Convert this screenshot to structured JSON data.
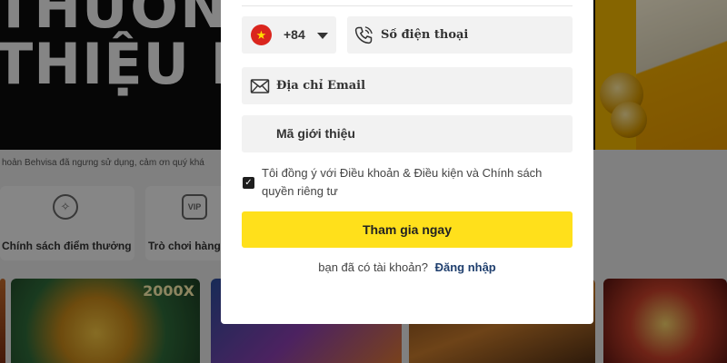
{
  "background": {
    "hero": {
      "line1": "THƯƠNG G",
      "line2": "THIỆU BẠ"
    },
    "notice": "hoản Behvisa đã ngưng sử dụng, cảm ơn quý khá",
    "categories": [
      {
        "label": "Chính sách điểm thưởng",
        "icon": "crest-icon"
      },
      {
        "label": "Trò chơi hàng",
        "icon": "vip-icon"
      }
    ],
    "games": [
      {
        "badge": "2000X"
      },
      {
        "badge": ""
      },
      {
        "badge": ""
      },
      {
        "badge": ""
      }
    ]
  },
  "form": {
    "country": {
      "flag": "vietnam-flag",
      "dial_code": "+84"
    },
    "phone": {
      "placeholder": "Số điện thoại",
      "value": ""
    },
    "email": {
      "placeholder": "Địa chỉ Email",
      "value": ""
    },
    "referral": {
      "placeholder": "Mã giới thiệu",
      "value": ""
    },
    "terms": {
      "checked": true,
      "text": "Tôi đồng ý với Điều khoản & Điều kiện và Chính sách quyền riêng tư"
    },
    "submit_label": "Tham gia ngay",
    "login_prompt": "bạn đã có tài khoản?",
    "login_link": "Đăng nhập"
  },
  "colors": {
    "accent": "#ffe01b",
    "field_bg": "#f2f2f2",
    "link": "#1f3f6e",
    "flag_red": "#da251d",
    "flag_star": "#ffde00"
  }
}
